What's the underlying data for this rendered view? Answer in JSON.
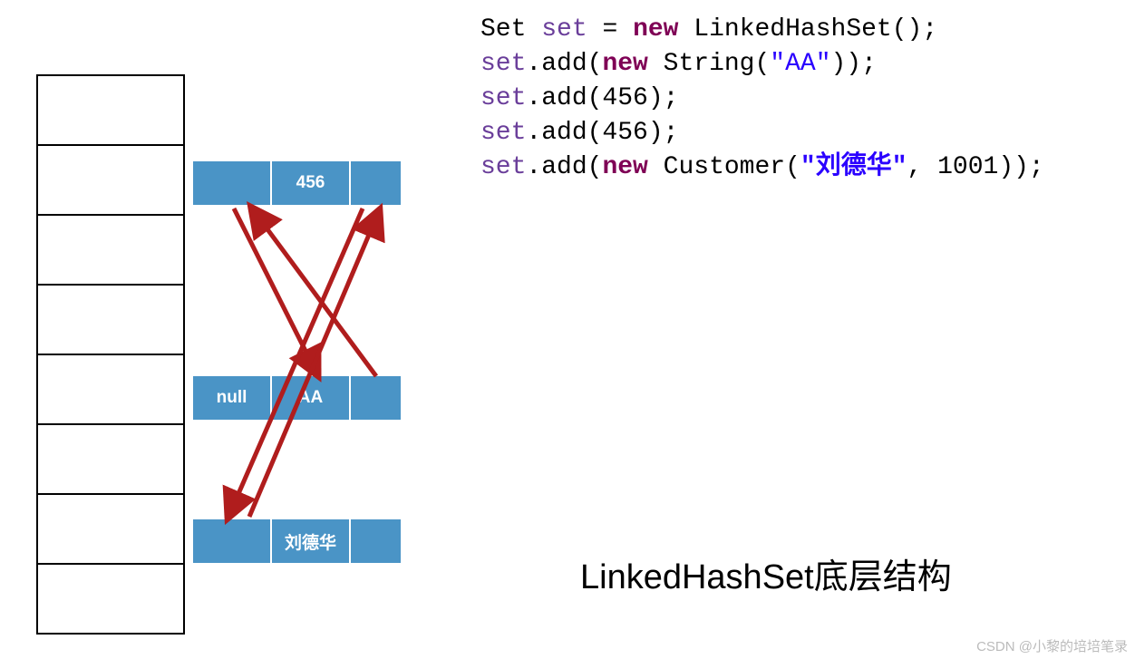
{
  "diagram": {
    "title": "LinkedHashSet底层结构",
    "array_slots": 8,
    "nodes": [
      {
        "prev": "",
        "value": "456",
        "next": ""
      },
      {
        "prev": "null",
        "value": "AA",
        "next": ""
      },
      {
        "prev": "",
        "value": "刘德华",
        "next": ""
      }
    ]
  },
  "code": {
    "line1": {
      "t1": "Set ",
      "var": "set",
      "t2": " = ",
      "kw": "new",
      "t3": " LinkedHashSet();"
    },
    "line2": {
      "var": "set",
      "t1": ".add(",
      "kw": "new",
      "t2": " String(",
      "str": "\"AA\"",
      "t3": "));"
    },
    "line3": {
      "var": "set",
      "t1": ".add(456);"
    },
    "line4": {
      "var": "set",
      "t1": ".add(456);"
    },
    "line5": {
      "var": "set",
      "t1": ".add(",
      "kw": "new",
      "t2": " Customer(",
      "str": "\"刘德华\"",
      "t3": ", 1001));"
    }
  },
  "watermark": "CSDN @小黎的培培笔录"
}
